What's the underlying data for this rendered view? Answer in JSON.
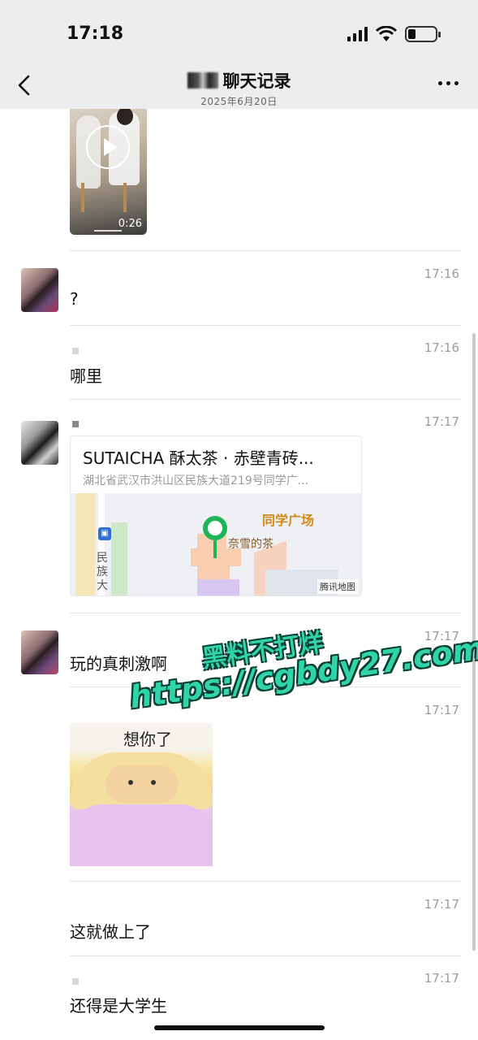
{
  "status_bar": {
    "time": "17:18"
  },
  "header": {
    "title": "聊天记录",
    "date": "2025年6月20日"
  },
  "messages": [
    {
      "type": "video",
      "duration": "0:26"
    },
    {
      "type": "text",
      "time": "17:16",
      "text": "?"
    },
    {
      "type": "text",
      "time": "17:16",
      "text": "哪里"
    },
    {
      "type": "location",
      "time": "17:17",
      "title": "SUTAICHA 酥太茶 · 赤壁青砖...",
      "address": "湖北省武汉市洪山区民族大道219号同学广...",
      "map": {
        "place_label": "同学广场",
        "shop_label": "奈雪的茶",
        "road_label": "民族大",
        "provider": "腾讯地图",
        "bus_icon": "bus-stop-icon"
      }
    },
    {
      "type": "text",
      "time": "17:17",
      "text": "玩的真刺激啊"
    },
    {
      "type": "sticker",
      "time": "17:17",
      "sticker_text": "想你了"
    },
    {
      "type": "text",
      "time": "17:17",
      "text": "这就做上了"
    },
    {
      "type": "text",
      "time": "17:17",
      "text": "还得是大学生"
    }
  ],
  "watermark": {
    "line1": "黑料不打烊",
    "line2": "https://cgbdy27.com"
  },
  "colors": {
    "header_bg": "#ededed",
    "pin_green": "#1db45a",
    "watermark": "#2fd4a8"
  }
}
